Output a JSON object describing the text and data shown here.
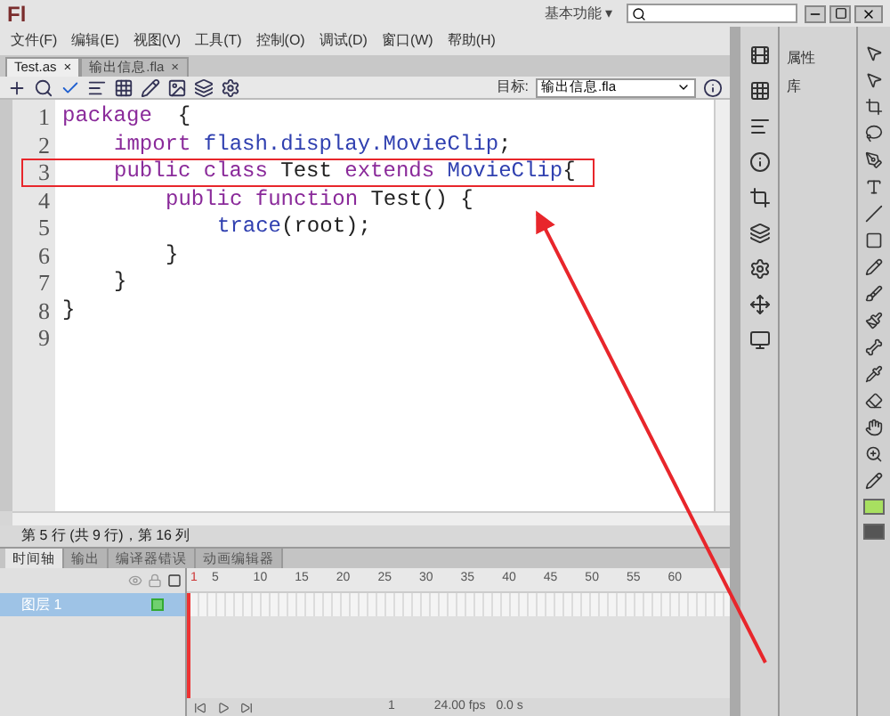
{
  "title_bar": {
    "logo": "Fl",
    "workspace": "基本功能",
    "workspace_caret": "▾"
  },
  "menu": [
    "文件(F)",
    "编辑(E)",
    "视图(V)",
    "工具(T)",
    "控制(O)",
    "调试(D)",
    "窗口(W)",
    "帮助(H)"
  ],
  "doc_tabs": [
    {
      "label": "Test.as",
      "close": "×",
      "selected": true
    },
    {
      "label": "输出信息.fla",
      "close": "×",
      "selected": false
    }
  ],
  "toolbar": {
    "target_label": "目标:",
    "target_value": "输出信息.fla"
  },
  "code_lines": [
    {
      "number": "1",
      "highlighted": false,
      "tokens": [
        {
          "kind": "keyword",
          "text": "package"
        },
        {
          "kind": "plain",
          "text": "  {"
        }
      ],
      "children": [
        {
          "number": "2",
          "highlighted": false,
          "tokens": [
            {
              "kind": "keyword",
              "text": "import"
            },
            {
              "kind": "type",
              "text": " flash.display.MovieClip"
            },
            {
              "kind": "plain",
              "text": ";"
            }
          ]
        },
        {
          "number": "3",
          "highlighted": true,
          "tokens": [
            {
              "kind": "keyword",
              "text": "public class"
            },
            {
              "kind": "plain",
              "text": " Test "
            },
            {
              "kind": "keyword",
              "text": "extends"
            },
            {
              "kind": "type",
              "text": " MovieClip"
            },
            {
              "kind": "plain",
              "text": "{"
            }
          ],
          "children": [
            {
              "number": "4",
              "highlighted": false,
              "tokens": [
                {
                  "kind": "keyword",
                  "text": "public function"
                },
                {
                  "kind": "plain",
                  "text": " Test() {"
                }
              ],
              "children": [
                {
                  "number": "5",
                  "highlighted": false,
                  "tokens": [
                    {
                      "kind": "type",
                      "text": "trace"
                    },
                    {
                      "kind": "plain",
                      "text": "(root);"
                    }
                  ]
                }
              ]
            },
            {
              "number": "6",
              "highlighted": false,
              "tokens": [
                {
                  "kind": "plain",
                  "text": "}"
                }
              ]
            }
          ]
        },
        {
          "number": "7",
          "highlighted": false,
          "tokens": [
            {
              "kind": "plain",
              "text": "}"
            }
          ]
        }
      ]
    },
    {
      "number": "8",
      "highlighted": false,
      "tokens": [
        {
          "kind": "plain",
          "text": "}"
        }
      ]
    },
    {
      "number": "9",
      "highlighted": false
    }
  ],
  "status": "第 5 行 (共 9 行)，第 16 列",
  "timeline_tabs": [
    {
      "label": "时间轴",
      "selected": true
    },
    {
      "label": "输出",
      "selected": false
    },
    {
      "label": "编译器错误",
      "selected": false
    },
    {
      "label": "动画编辑器",
      "selected": false
    }
  ],
  "frame_numbers": [
    "1",
    "5",
    "10",
    "15",
    "20",
    "25",
    "30",
    "35",
    "40",
    "45",
    "50",
    "55",
    "60"
  ],
  "layers": [
    {
      "name": "图层 1",
      "selected": true
    }
  ],
  "timeline_footer": {
    "frame": "1",
    "fps": "24.00 fps",
    "time": "0.0 s"
  },
  "panels": [
    {
      "label": "属性"
    },
    {
      "label": "库"
    }
  ]
}
